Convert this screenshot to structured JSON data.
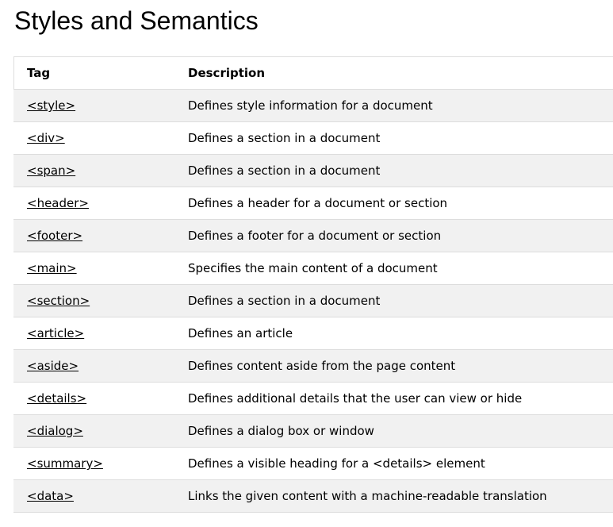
{
  "page": {
    "title": "Styles and Semantics"
  },
  "table": {
    "headers": {
      "tag": "Tag",
      "description": "Description"
    },
    "rows": [
      {
        "tag": "<style>",
        "description": "Defines style information for a document"
      },
      {
        "tag": "<div>",
        "description": "Defines a section in a document"
      },
      {
        "tag": "<span>",
        "description": "Defines a section in a document"
      },
      {
        "tag": "<header>",
        "description": "Defines a header for a document or section"
      },
      {
        "tag": "<footer>",
        "description": "Defines a footer for a document or section"
      },
      {
        "tag": "<main>",
        "description": "Specifies the main content of a document"
      },
      {
        "tag": "<section>",
        "description": "Defines a section in a document"
      },
      {
        "tag": "<article>",
        "description": "Defines an article"
      },
      {
        "tag": "<aside>",
        "description": "Defines content aside from the page content"
      },
      {
        "tag": "<details>",
        "description": "Defines additional details that the user can view or hide"
      },
      {
        "tag": "<dialog>",
        "description": "Defines a dialog box or window"
      },
      {
        "tag": "<summary>",
        "description": "Defines a visible heading for a <details> element"
      },
      {
        "tag": "<data>",
        "description": "Links the given content with a machine-readable translation"
      }
    ]
  },
  "colors": {
    "stripe": "#f1f1f1",
    "border": "#dddddd",
    "text": "#000000"
  }
}
